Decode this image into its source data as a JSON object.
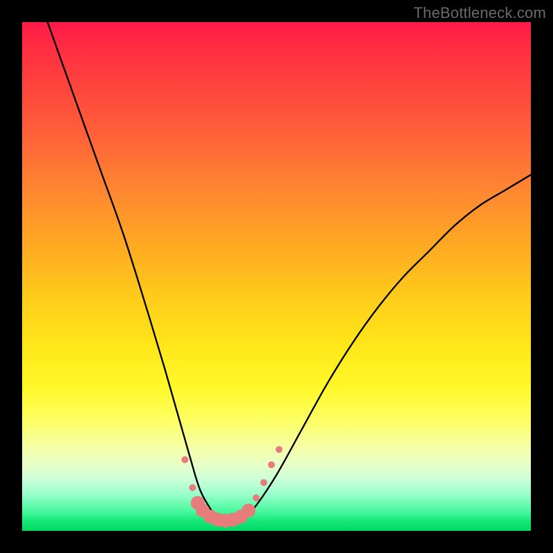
{
  "watermark": "TheBottleneck.com",
  "chart_data": {
    "type": "line",
    "title": "",
    "xlabel": "",
    "ylabel": "",
    "xlim": [
      0,
      100
    ],
    "ylim": [
      0,
      100
    ],
    "grid": false,
    "series": [
      {
        "name": "bottleneck-curve",
        "color": "#000000",
        "x": [
          5,
          10,
          15,
          20,
          25,
          28,
          30,
          32,
          34,
          35,
          36,
          38,
          40,
          42,
          44,
          46,
          50,
          55,
          60,
          65,
          70,
          75,
          80,
          85,
          90,
          95,
          100
        ],
        "values": [
          100,
          86,
          72,
          58,
          42,
          32,
          25,
          18,
          11,
          8,
          6,
          3,
          2,
          2,
          3,
          5,
          11,
          20,
          29,
          37,
          44,
          50,
          55,
          60,
          64,
          67,
          70
        ]
      }
    ],
    "markers": {
      "name": "highlighted-points",
      "color": "#e77c7c",
      "radius_small": 5,
      "radius_large": 10,
      "points": [
        {
          "x": 32.0,
          "y": 14.0,
          "r": "small"
        },
        {
          "x": 33.5,
          "y": 8.5,
          "r": "small"
        },
        {
          "x": 34.5,
          "y": 5.5,
          "r": "large"
        },
        {
          "x": 35.5,
          "y": 4.0,
          "r": "large"
        },
        {
          "x": 37.0,
          "y": 2.8,
          "r": "large"
        },
        {
          "x": 38.5,
          "y": 2.2,
          "r": "large"
        },
        {
          "x": 40.0,
          "y": 2.0,
          "r": "large"
        },
        {
          "x": 41.5,
          "y": 2.2,
          "r": "large"
        },
        {
          "x": 43.0,
          "y": 2.8,
          "r": "large"
        },
        {
          "x": 44.5,
          "y": 4.0,
          "r": "large"
        },
        {
          "x": 46.0,
          "y": 6.5,
          "r": "small"
        },
        {
          "x": 47.5,
          "y": 9.5,
          "r": "small"
        },
        {
          "x": 49.0,
          "y": 13.0,
          "r": "small"
        },
        {
          "x": 50.5,
          "y": 16.0,
          "r": "small"
        }
      ]
    }
  }
}
